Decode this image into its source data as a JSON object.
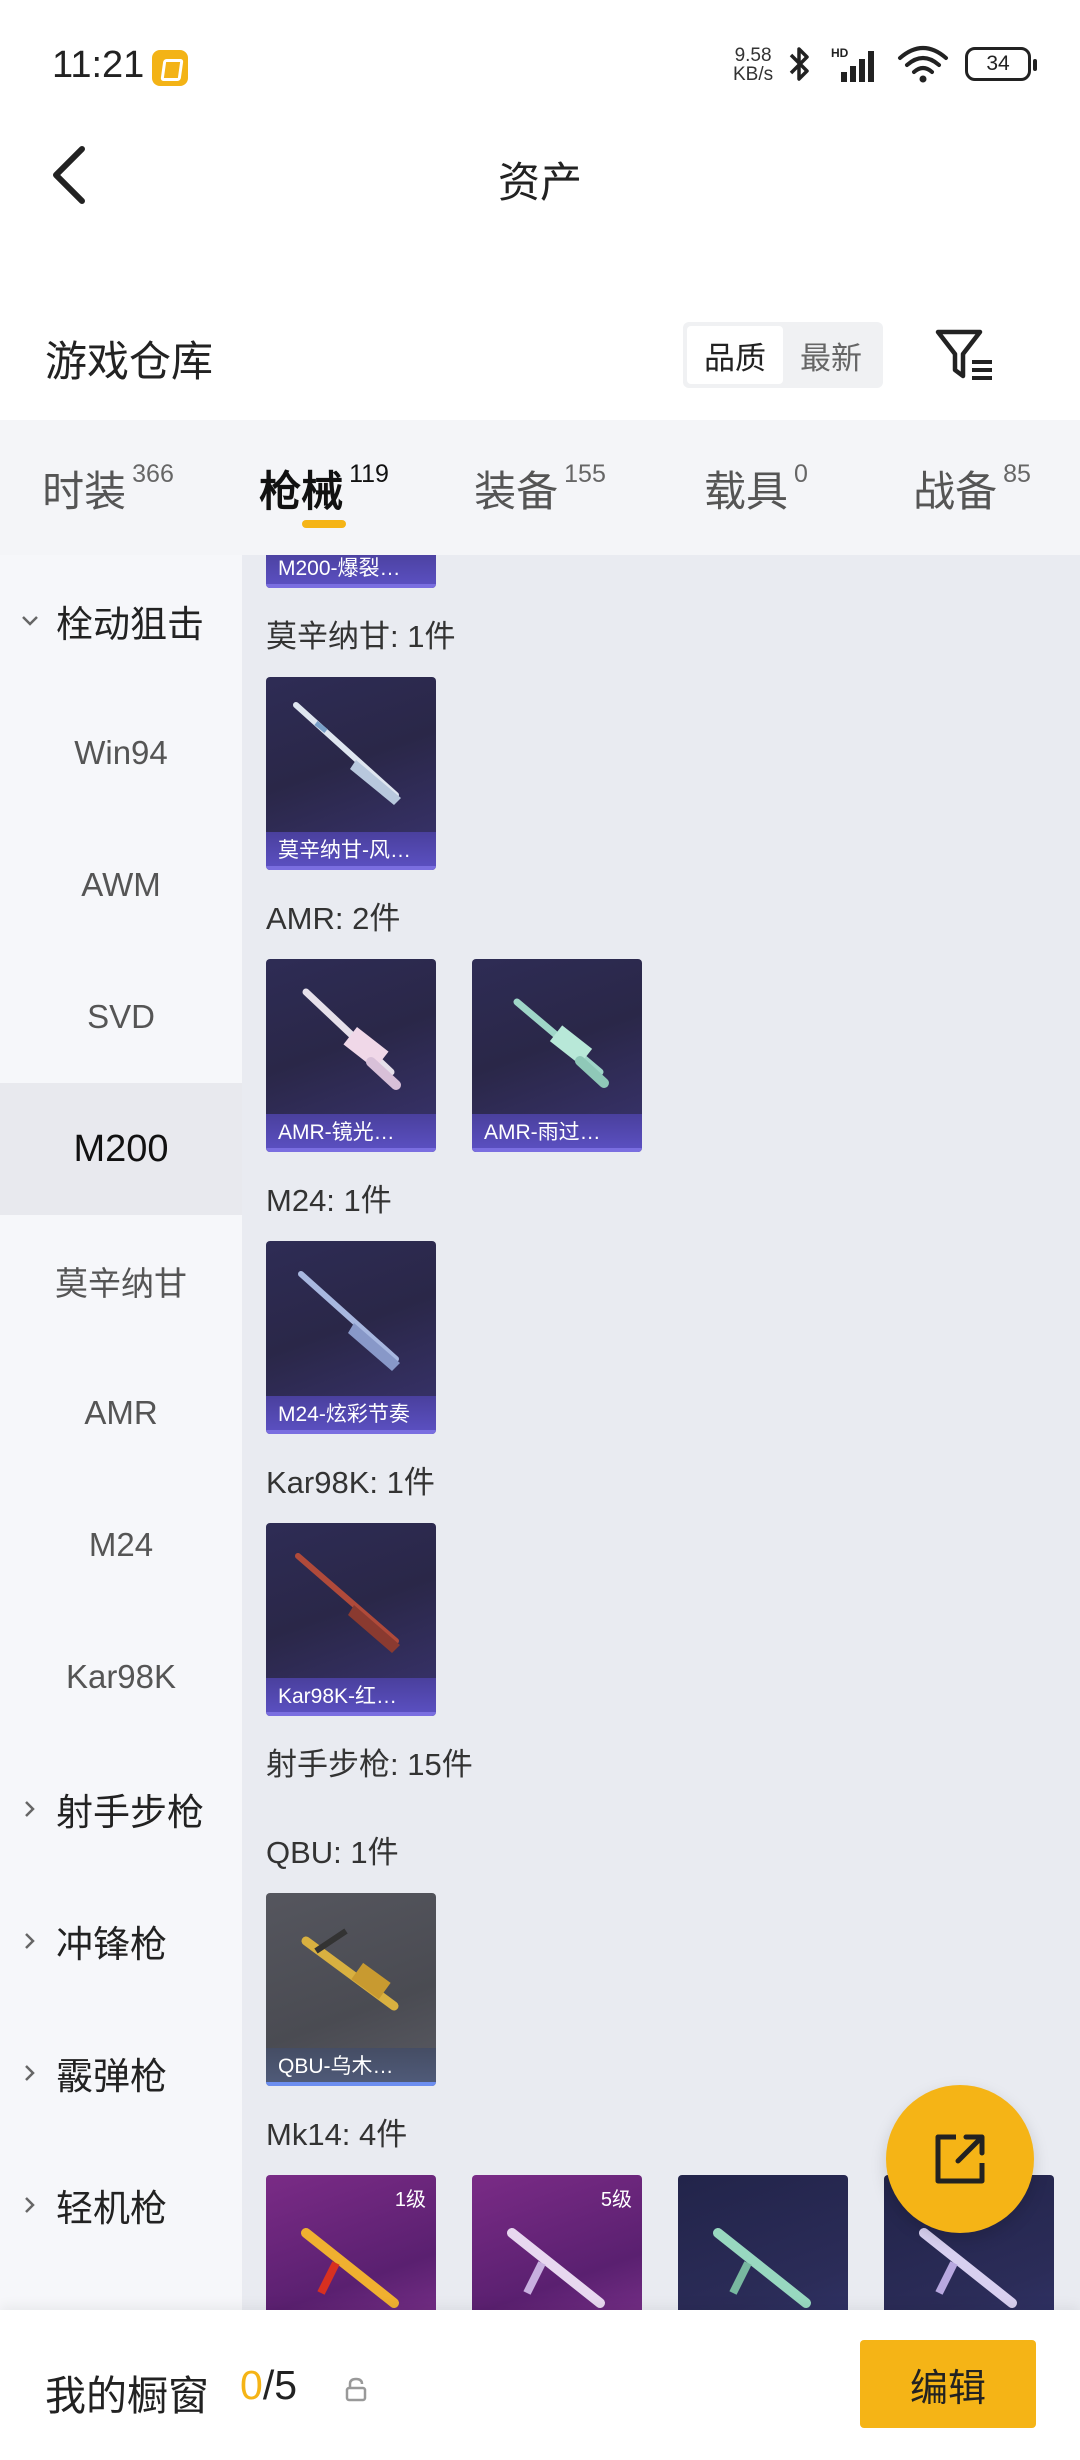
{
  "status_bar": {
    "time": "11:21",
    "net_speed_value": "9.58",
    "net_speed_unit": "KB/s",
    "battery": "34"
  },
  "header": {
    "title": "资产"
  },
  "warehouse": {
    "title": "游戏仓库",
    "sort_options": [
      "品质",
      "最新"
    ],
    "active_sort": "品质"
  },
  "category_tabs": [
    {
      "label": "时装",
      "count": "366"
    },
    {
      "label": "枪械",
      "count": "119"
    },
    {
      "label": "装备",
      "count": "155"
    },
    {
      "label": "载具",
      "count": "0"
    },
    {
      "label": "战备",
      "count": "85"
    }
  ],
  "active_tab": "枪械",
  "side_nav": {
    "groups": [
      {
        "label": "栓动狙击",
        "expanded": true
      },
      {
        "label": "射手步枪",
        "expanded": false
      },
      {
        "label": "冲锋枪",
        "expanded": false
      },
      {
        "label": "霰弹枪",
        "expanded": false
      },
      {
        "label": "轻机枪",
        "expanded": false
      }
    ],
    "sniper_items": [
      "Win94",
      "AWM",
      "SVD",
      "M200",
      "莫辛纳甘",
      "AMR",
      "M24",
      "Kar98K"
    ],
    "active_item": "M200"
  },
  "content": {
    "partial_card_name": "M200-爆裂…",
    "sections": [
      {
        "label": "莫辛纳甘: 1件",
        "cards": [
          {
            "name": "莫辛纳甘-风…"
          }
        ]
      },
      {
        "label": "AMR: 2件",
        "cards": [
          {
            "name": "AMR-镜光…"
          },
          {
            "name": "AMR-雨过…"
          }
        ]
      },
      {
        "label": "M24: 1件",
        "cards": [
          {
            "name": "M24-炫彩节奏"
          }
        ]
      },
      {
        "label": "Kar98K: 1件",
        "cards": [
          {
            "name": "Kar98K-红…"
          }
        ]
      },
      {
        "label": "射手步枪: 15件"
      },
      {
        "label": "QBU: 1件",
        "cards": [
          {
            "name": "QBU-乌木…"
          }
        ]
      },
      {
        "label": "Mk14: 4件",
        "cards": [
          {
            "level": "1级"
          },
          {
            "level": "5级"
          },
          {},
          {}
        ]
      }
    ]
  },
  "bottom_bar": {
    "showcase_label": "我的橱窗",
    "showcase_used": "0",
    "showcase_total": "/5",
    "edit_label": "编辑"
  },
  "colors": {
    "accent": "#f5b416",
    "tab_bg": "#f4f5f8",
    "content_bg": "#e9ebf1",
    "card_purple": "#2e2c55"
  }
}
